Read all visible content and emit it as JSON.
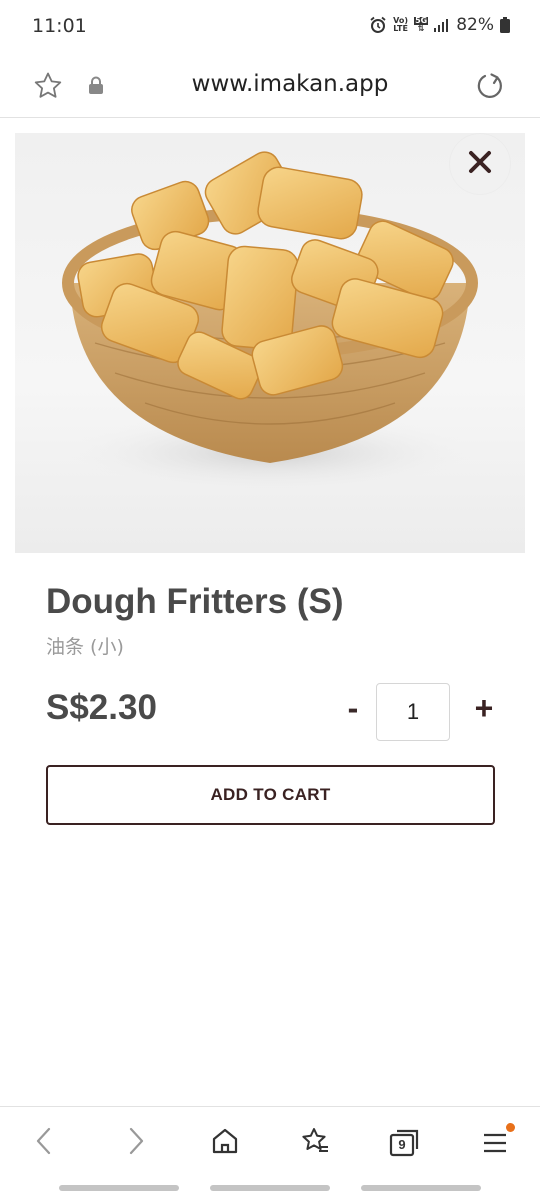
{
  "status_bar": {
    "time": "11:01",
    "network_top": "Vo)",
    "network_bottom": "LTE",
    "network_5g": "5G",
    "battery": "82%"
  },
  "browser": {
    "url": "www.imakan.app",
    "icons": [
      "star-icon",
      "lock-icon",
      "reload-icon"
    ]
  },
  "product": {
    "image_alt": "Dough Fritters in a wicker basket",
    "name": "Dough Fritters (S)",
    "name_cn": "油条 (小)",
    "price": "S$2.30",
    "quantity": "1",
    "qty_minus": "-",
    "qty_plus": "+",
    "add_to_cart": "ADD TO CART"
  },
  "bottom_nav": {
    "tabs_count": "9",
    "items": [
      "back-icon",
      "forward-icon",
      "home-icon",
      "bookmarks-icon",
      "tabs-icon",
      "menu-icon"
    ]
  },
  "colors": {
    "accent": "#3a2222",
    "text": "#4a4a4a",
    "subtext": "#9a9a9a",
    "notification_dot": "#e8701a"
  }
}
